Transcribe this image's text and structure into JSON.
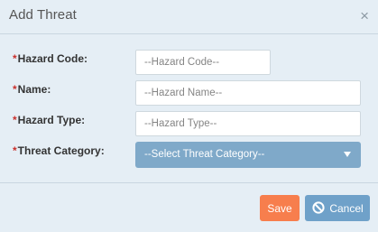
{
  "dialog": {
    "title": "Add Threat",
    "close_glyph": "×"
  },
  "form": {
    "required_marker": "*",
    "hazard_code": {
      "label": "Hazard Code:",
      "placeholder": "--Hazard Code--"
    },
    "name": {
      "label": "Name:",
      "placeholder": "--Hazard Name--"
    },
    "hazard_type": {
      "label": "Hazard Type:",
      "placeholder": "--Hazard Type--"
    },
    "threat_category": {
      "label": "Threat Category:",
      "selected": "--Select Threat Category--"
    }
  },
  "buttons": {
    "save": "Save",
    "cancel": "Cancel"
  },
  "colors": {
    "save": "#f77e4d",
    "cancel": "#6fa1c9",
    "select": "#7fa9c9",
    "required": "#c9302c"
  },
  "icons": {
    "close": "close-icon",
    "cancel": "ban-icon",
    "dropdown": "caret-down-icon"
  }
}
